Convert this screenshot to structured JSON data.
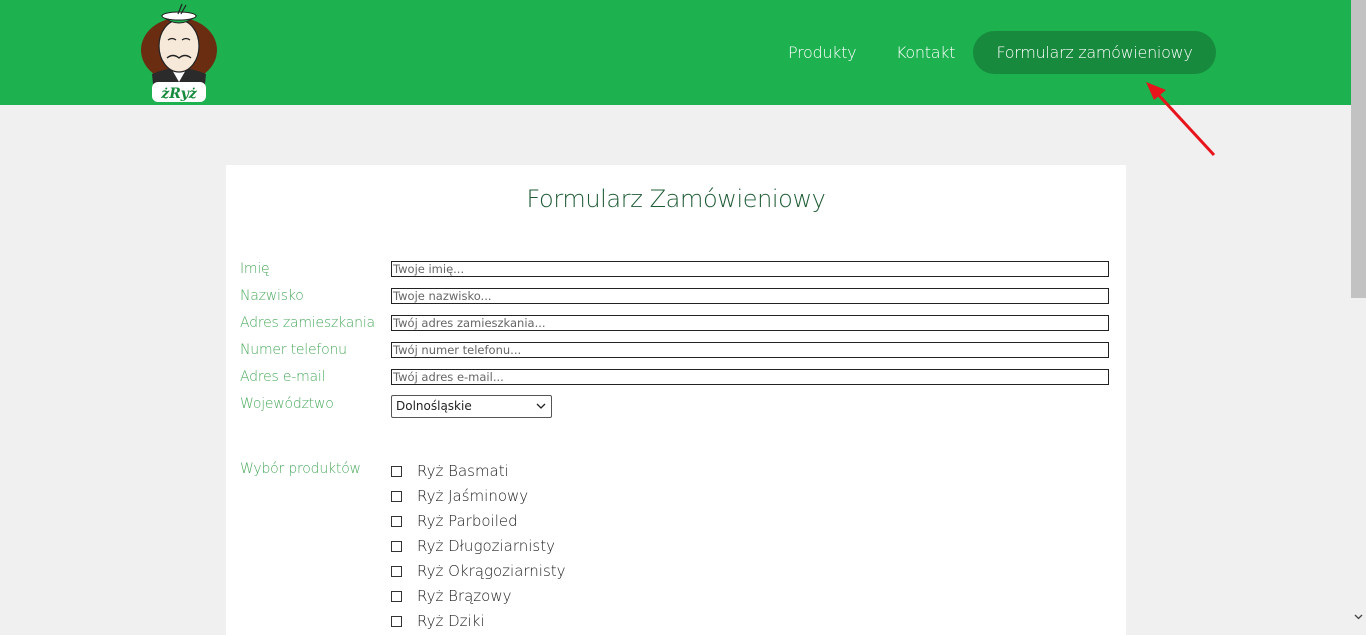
{
  "nav": {
    "items": [
      "Produkty",
      "Kontakt",
      "Formularz zamówieniowy"
    ],
    "active": "Formularz zamówieniowy"
  },
  "logo": {
    "text": "żRyż"
  },
  "form": {
    "title": "Formularz Zamówieniowy",
    "fields": [
      {
        "label": "Imię",
        "placeholder": "Twoje imię..."
      },
      {
        "label": "Nazwisko",
        "placeholder": "Twoje nazwisko..."
      },
      {
        "label": "Adres zamieszkania",
        "placeholder": "Twój adres zamieszkania..."
      },
      {
        "label": "Numer telefonu",
        "placeholder": "Twój numer telefonu..."
      },
      {
        "label": "Adres e-mail",
        "placeholder": "Twój adres e-mail..."
      }
    ],
    "voivodeship": {
      "label": "Województwo",
      "selected": "Dolnośląskie"
    },
    "products": {
      "label": "Wybór produktów",
      "items": [
        "Ryż Basmati",
        "Ryż Jaśminowy",
        "Ryż Parboiled",
        "Ryż Długoziarnisty",
        "Ryż Okrągoziarnisty",
        "Ryż Brązowy",
        "Ryż Dziki"
      ]
    }
  },
  "colors": {
    "header": "#1db14f",
    "active_nav": "#178a3d",
    "label": "#4caa5f",
    "title": "#1f5c35",
    "annotation_arrow": "#e8141c"
  }
}
